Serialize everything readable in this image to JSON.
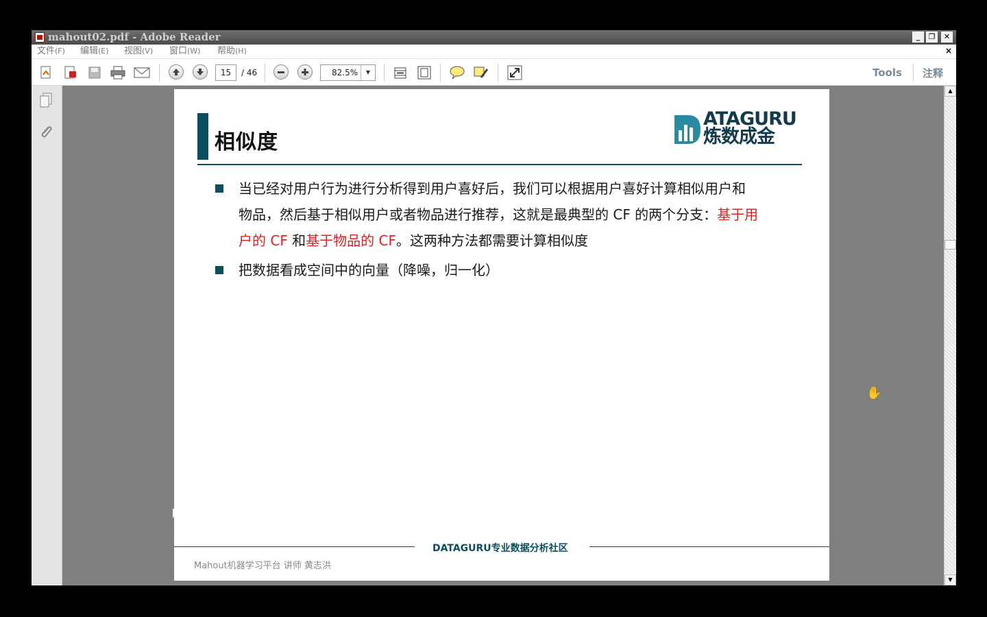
{
  "window": {
    "title": "mahout02.pdf - Adobe Reader",
    "controls": {
      "minimize": "_",
      "restore": "❐",
      "close": "✕"
    }
  },
  "menu": {
    "items": [
      {
        "label": "文件",
        "accel": "(F)"
      },
      {
        "label": "编辑",
        "accel": "(E)"
      },
      {
        "label": "视图",
        "accel": "(V)"
      },
      {
        "label": "窗口",
        "accel": "(W)"
      },
      {
        "label": "帮助",
        "accel": "(H)"
      }
    ],
    "doc_close": "×"
  },
  "toolbar": {
    "current_page": "15",
    "total_pages": "/ 46",
    "zoom": "82.5%",
    "tools_label": "Tools",
    "comment_label": "注释"
  },
  "slide": {
    "title": "相似度",
    "logo_en": "ATAGURU",
    "logo_cn": "炼数成金",
    "bullet1_line1": "当已经对用户行为进行分析得到用户喜好后，我们可以根据用户喜好计算相似用户和",
    "bullet1_line2_a": "物品，然后基于相似用户或者物品进行推荐，这就是最典型的 CF 的两个分支：",
    "bullet1_line2_red": "基于用",
    "bullet1_line3_red1": "户的 CF",
    "bullet1_line3_b": " 和",
    "bullet1_line3_red2": "基于物品的 CF",
    "bullet1_line3_c": "。这两种方法都需要计算相似度",
    "bullet2": "把数据看成空间中的向量（降噪，归一化）",
    "footer_center": "DATAGURU专业数据分析社区",
    "footer_left": "Mahout机器学习平台    讲师 黄志洪"
  },
  "colors": {
    "accent": "#0c4d5f",
    "highlight_red": "#e02020",
    "workspace_gray": "#7f7f7f"
  }
}
